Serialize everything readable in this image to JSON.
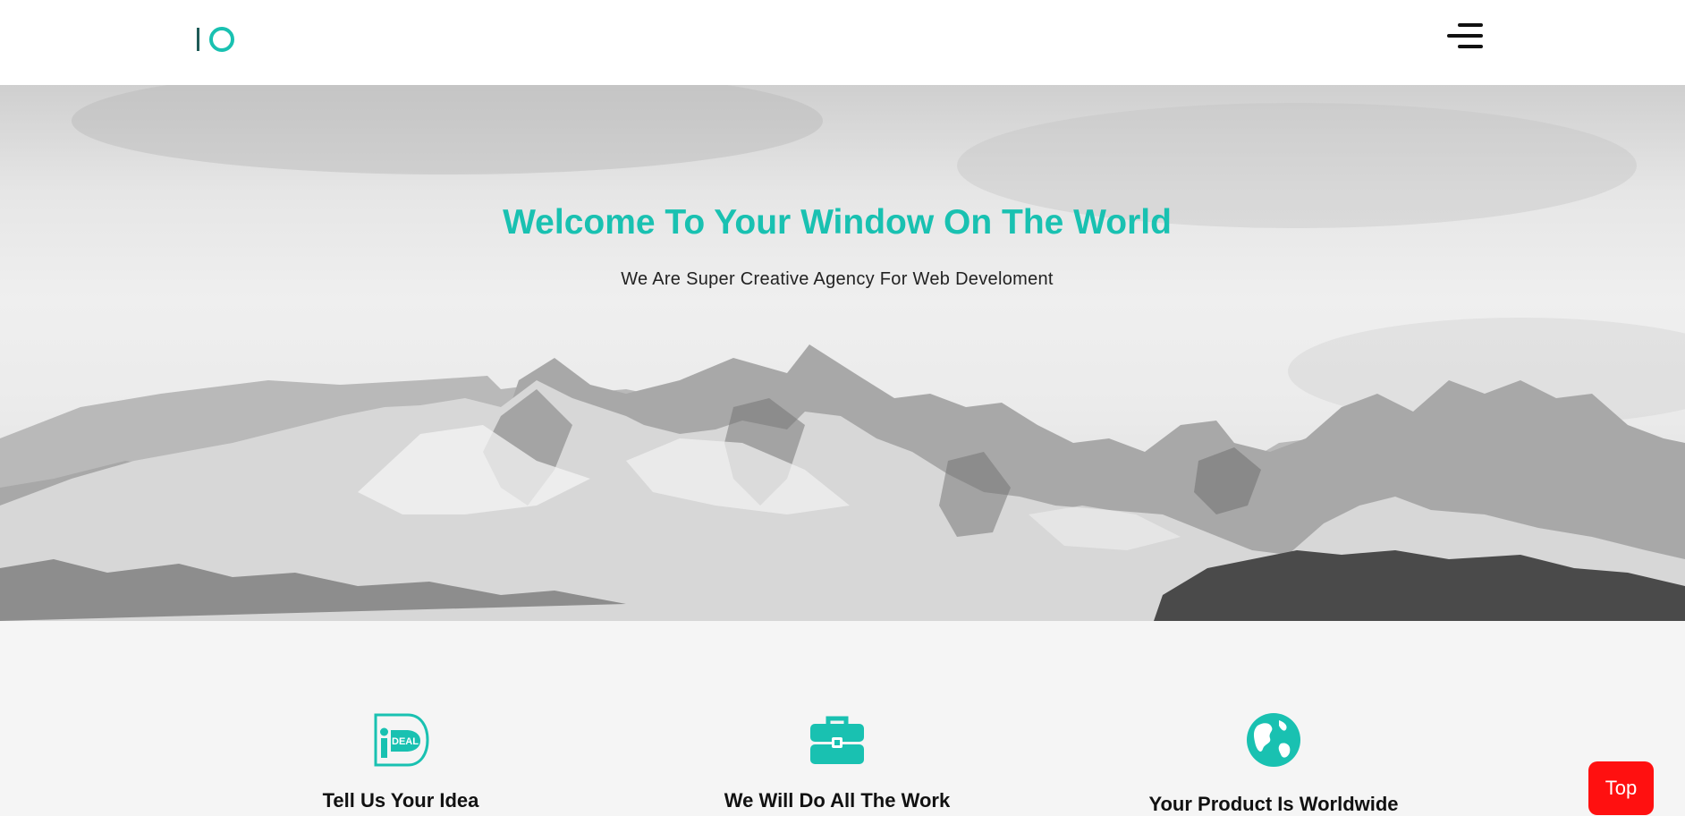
{
  "header": {
    "logo_icon": "io-logo-icon",
    "menu_icon": "hamburger-menu-icon"
  },
  "hero": {
    "title": "Welcome To Your Window On The World",
    "subtitle": "We Are Super Creative Agency For Web Develoment",
    "background": "grayscale-snowy-mountains-image"
  },
  "features": [
    {
      "icon": "ideal-icon",
      "title": "Tell Us Your Idea"
    },
    {
      "icon": "briefcase-icon",
      "title": "We Will Do All The Work"
    },
    {
      "icon": "globe-icon",
      "title": "Your Product Is Worldwide"
    }
  ],
  "scroll_top": {
    "label": "Top"
  },
  "colors": {
    "accent": "#19c1b1",
    "logo_bar": "#1f5b57",
    "top_button": "#ff1010",
    "section_bg": "#f5f5f5",
    "header_bg": "#ffffff"
  }
}
